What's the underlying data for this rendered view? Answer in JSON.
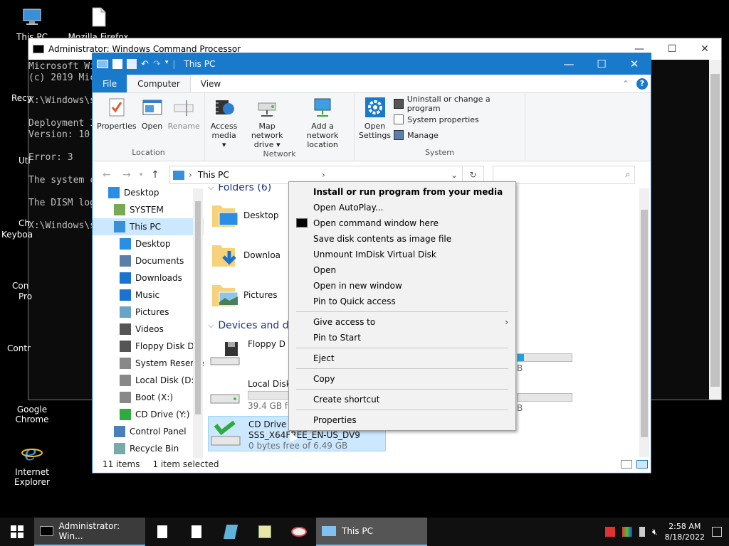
{
  "desktop": {
    "icons": [
      {
        "label": "This PC"
      },
      {
        "label": "Mozilla Firefox"
      },
      {
        "label": "Google Chrome"
      },
      {
        "label": "Internet Explorer"
      }
    ],
    "partial_labels": [
      "Recy",
      "Uti",
      "Ch",
      "Keyboa",
      "Con",
      "Pro",
      "Contr"
    ]
  },
  "cmd": {
    "title": "Administrator: Windows Command Processor",
    "lines": [
      "Microsoft Wi",
      "(c) 2019 Mic",
      "",
      "X:\\Windows\\s",
      "",
      "Deployment I",
      "Version: 10.",
      "",
      "Error: 3",
      "",
      "The system c",
      "",
      "The DISM log",
      "",
      "X:\\Windows\\s"
    ]
  },
  "explorer": {
    "title": "This PC",
    "tabs": {
      "file": "File",
      "computer": "Computer",
      "view": "View"
    },
    "ribbon": {
      "location": {
        "label": "Location",
        "properties": "Properties",
        "open": "Open",
        "rename": "Rename"
      },
      "network": {
        "label": "Network",
        "access_media": "Access",
        "access_media_2": "media ▾",
        "map_drive": "Map network",
        "map_drive_2": "drive ▾",
        "add_location": "Add a network",
        "add_location_2": "location"
      },
      "system": {
        "label": "System",
        "open_settings": "Open",
        "open_settings_2": "Settings",
        "uninstall": "Uninstall or change a program",
        "system_properties": "System properties",
        "manage": "Manage"
      }
    },
    "address": {
      "crumb": "This PC"
    },
    "search": {
      "placeholder": ""
    },
    "nav": [
      {
        "label": "Desktop",
        "indent": 0,
        "selected": false
      },
      {
        "label": "SYSTEM",
        "indent": 1,
        "selected": false
      },
      {
        "label": "This PC",
        "indent": 1,
        "selected": true
      },
      {
        "label": "Desktop",
        "indent": 2,
        "selected": false
      },
      {
        "label": "Documents",
        "indent": 2,
        "selected": false
      },
      {
        "label": "Downloads",
        "indent": 2,
        "selected": false
      },
      {
        "label": "Music",
        "indent": 2,
        "selected": false
      },
      {
        "label": "Pictures",
        "indent": 2,
        "selected": false
      },
      {
        "label": "Videos",
        "indent": 2,
        "selected": false
      },
      {
        "label": "Floppy Disk Dri",
        "indent": 2,
        "selected": false
      },
      {
        "label": "System Reserve",
        "indent": 2,
        "selected": false
      },
      {
        "label": "Local Disk (D:)",
        "indent": 2,
        "selected": false
      },
      {
        "label": "Boot (X:)",
        "indent": 2,
        "selected": false
      },
      {
        "label": "CD Drive (Y:) SS",
        "indent": 2,
        "selected": false
      },
      {
        "label": "Control Panel",
        "indent": 1,
        "selected": false
      },
      {
        "label": "Recycle Bin",
        "indent": 1,
        "selected": false
      }
    ],
    "folders_header": "Folders (6)",
    "folders": [
      {
        "label": "Desktop"
      },
      {
        "label": "Downloa"
      },
      {
        "label": "Pictures"
      }
    ],
    "devices_header": "Devices and d",
    "drives": [
      {
        "name": "Floppy D",
        "free": "",
        "fill_percent": 0
      },
      {
        "name": "Local Disk",
        "free": "39.4 GB f",
        "fill_percent": 0
      },
      {
        "name": "CD Drive",
        "sub": "SSS_X64FREE_EN-US_DV9",
        "free": "0 bytes free of 6.49 GB",
        "fill_percent": 0
      }
    ],
    "right_bars": [
      {
        "suffix": "B",
        "fill_percent": 12
      },
      {
        "suffix": "B",
        "fill_percent": 0
      }
    ],
    "status": {
      "items": "11 items",
      "selected": "1 item selected"
    }
  },
  "context_menu": {
    "items": [
      {
        "label": "Install or run program from your media",
        "bold": true
      },
      {
        "label": "Open AutoPlay..."
      },
      {
        "label": "Open command window here",
        "icon": "cmd-icon"
      },
      {
        "label": "Save disk contents as image file"
      },
      {
        "label": "Unmount ImDisk Virtual Disk"
      },
      {
        "label": "Open"
      },
      {
        "label": "Open in new window"
      },
      {
        "label": "Pin to Quick access"
      },
      {
        "sep": true
      },
      {
        "label": "Give access to",
        "submenu": true
      },
      {
        "label": "Pin to Start"
      },
      {
        "sep": true
      },
      {
        "label": "Eject"
      },
      {
        "sep": true
      },
      {
        "label": "Copy"
      },
      {
        "sep": true
      },
      {
        "label": "Create shortcut"
      },
      {
        "sep": true
      },
      {
        "label": "Properties"
      }
    ]
  },
  "taskbar": {
    "cmd_app": "Administrator: Win...",
    "explorer_app": "This PC",
    "time": "2:58 AM",
    "date": "8/18/2022"
  }
}
